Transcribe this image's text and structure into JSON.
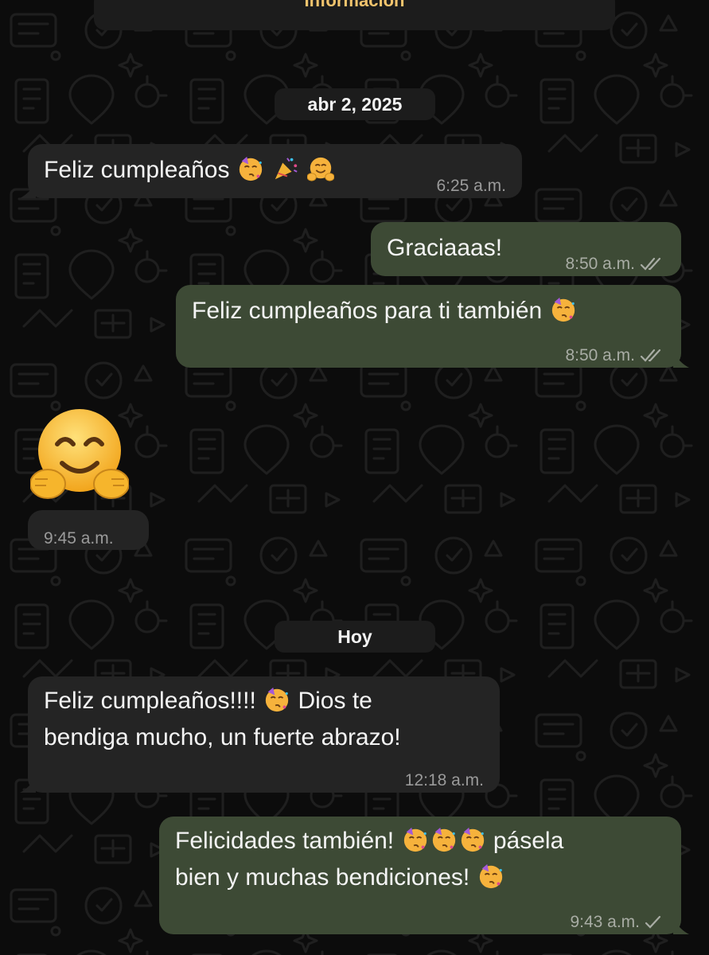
{
  "header": {
    "info_label": "Información"
  },
  "date_dividers": {
    "first": "abr 2, 2025",
    "second": "Hoy"
  },
  "messages": [
    {
      "direction": "incoming",
      "text": "Feliz cumpleaños",
      "emojis": [
        "partying-face",
        "party-popper",
        "hugging-face"
      ],
      "time": "6:25 a.m."
    },
    {
      "direction": "outgoing",
      "text": "Graciaaas!",
      "time": "8:50 a.m.",
      "status": "read"
    },
    {
      "direction": "outgoing",
      "text": "Feliz cumpleaños para ti también",
      "emojis": [
        "partying-face"
      ],
      "time": "8:50 a.m.",
      "status": "read"
    },
    {
      "direction": "incoming",
      "big_emoji": "hugging-face",
      "time": "9:45 a.m."
    },
    {
      "direction": "incoming",
      "line1": "Feliz cumpleaños!!!!",
      "line1_tail": "Dios te",
      "line2": "bendiga mucho, un fuerte abrazo!",
      "time": "12:18 a.m."
    },
    {
      "direction": "outgoing",
      "line1": "Felicidades también!",
      "line1_tail": "pásela",
      "line2": "bien y muchas bendiciones!",
      "time": "9:43 a.m.",
      "status": "sent"
    }
  ],
  "colors": {
    "background": "#0c0c0c",
    "incoming_bubble": "#242424",
    "outgoing_bubble": "#3d4a35",
    "header_accent": "#f2c46d",
    "timestamp": "#9a9a9a"
  }
}
